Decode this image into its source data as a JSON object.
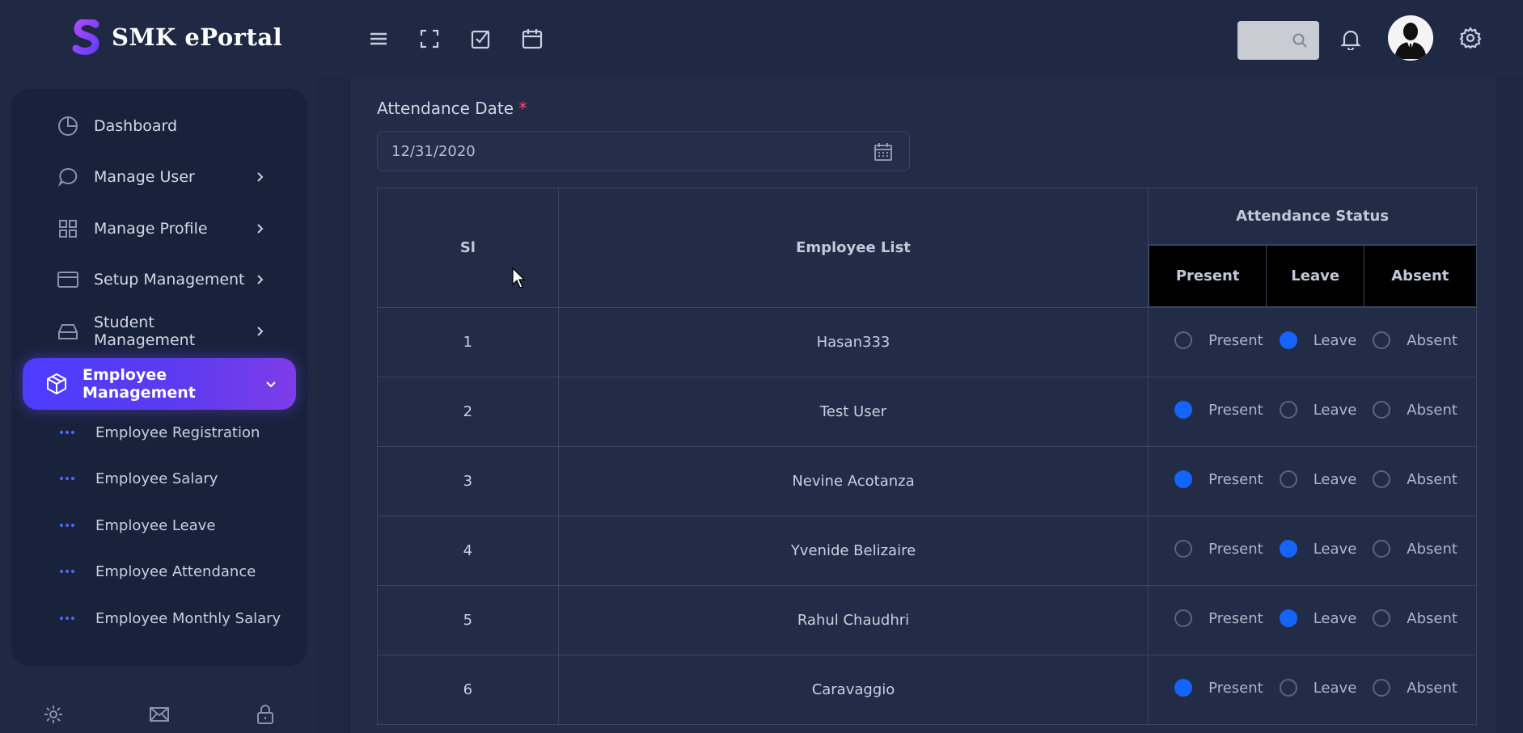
{
  "brand": {
    "name": "SMK ePortal"
  },
  "sidebar": {
    "items": [
      {
        "label": "Dashboard",
        "icon": "pie-chart-icon"
      },
      {
        "label": "Manage User",
        "icon": "chat-bubble-icon"
      },
      {
        "label": "Manage Profile",
        "icon": "grid-icon"
      },
      {
        "label": "Setup Management",
        "icon": "credit-card-icon"
      },
      {
        "label": "Student Management",
        "icon": "inbox-icon"
      },
      {
        "label": "Employee Management",
        "icon": "box-icon"
      }
    ],
    "subitems": [
      {
        "label": "Employee Registration"
      },
      {
        "label": "Employee Salary"
      },
      {
        "label": "Employee Leave"
      },
      {
        "label": "Employee Attendance"
      },
      {
        "label": "Employee Monthly Salary"
      }
    ],
    "footer_icons": [
      "settings-icon",
      "mail-icon",
      "lock-icon"
    ]
  },
  "topbar": {
    "icons": [
      "menu-icon",
      "fullscreen-icon",
      "checkbox-icon",
      "calendar-icon"
    ],
    "right_icons": [
      "search-icon",
      "bell-icon",
      "settings-icon"
    ]
  },
  "form": {
    "date_label": "Attendance Date",
    "required_mark": "*",
    "date_value": "12/31/2020"
  },
  "table": {
    "headers": {
      "sl": "Sl",
      "employee": "Employee List",
      "status": "Attendance Status"
    },
    "status_options": [
      "Present",
      "Leave",
      "Absent"
    ],
    "rows": [
      {
        "sl": "1",
        "name": "Hasan333",
        "status": "Leave"
      },
      {
        "sl": "2",
        "name": "Test User",
        "status": "Present"
      },
      {
        "sl": "3",
        "name": "Nevine Acotanza",
        "status": "Present"
      },
      {
        "sl": "4",
        "name": "Yvenide Belizaire",
        "status": "Leave"
      },
      {
        "sl": "5",
        "name": "Rahul Chaudhri",
        "status": "Leave"
      },
      {
        "sl": "6",
        "name": "Caravaggio",
        "status": "Present"
      }
    ]
  },
  "colors": {
    "accent": "#1464ff",
    "active_gradient_start": "#4c3cff",
    "active_gradient_end": "#7e3ce8"
  }
}
